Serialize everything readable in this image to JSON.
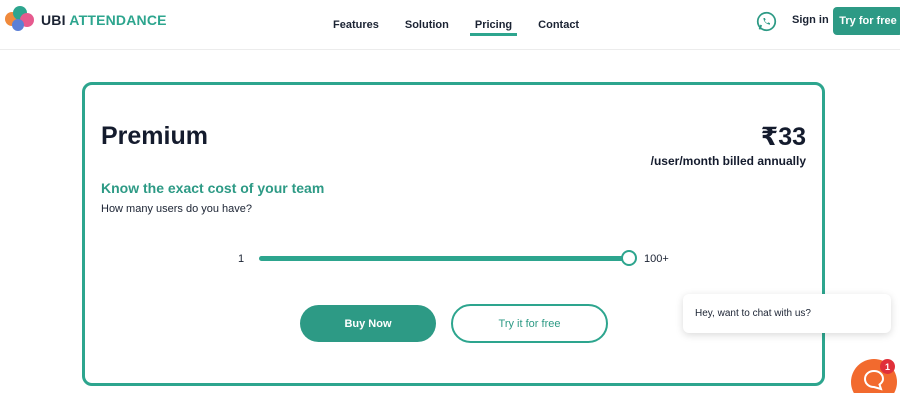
{
  "brand": {
    "name_part1": "UBI",
    "name_part2": "ATTENDANCE"
  },
  "nav": {
    "items": [
      {
        "label": "Features",
        "active": false
      },
      {
        "label": "Solution",
        "active": false
      },
      {
        "label": "Pricing",
        "active": true
      },
      {
        "label": "Contact",
        "active": false
      }
    ]
  },
  "header": {
    "signin_label": "Sign in",
    "try_label": "Try for free",
    "whatsapp_icon": "whatsapp-icon"
  },
  "plan": {
    "name": "Premium",
    "price": "₹33",
    "price_note": "/user/month billed annually",
    "know_heading": "Know the exact cost of your team",
    "question": "How many users do you have?"
  },
  "slider": {
    "min_label": "1",
    "max_label": "100+",
    "value_fraction": 1.0
  },
  "actions": {
    "buy_label": "Buy Now",
    "trial_label": "Try it for free"
  },
  "chat": {
    "message": "Hey, want to chat with us?",
    "badge_count": "1"
  },
  "colors": {
    "accent": "#2da58e",
    "accent_dark": "#2d9a85",
    "chat_orange": "#f26a2e",
    "badge_red": "#e0303a"
  }
}
